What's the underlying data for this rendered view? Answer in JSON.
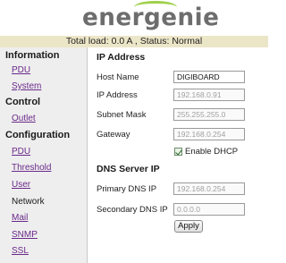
{
  "brand": {
    "logo_text": "energenie",
    "accent_color": "#9fd04a"
  },
  "status_bar": {
    "text": "Total load: 0.0 A , Status: Normal"
  },
  "sidebar": {
    "sections": [
      {
        "heading": "Information",
        "items": [
          {
            "label": "PDU"
          },
          {
            "label": "System"
          }
        ]
      },
      {
        "heading": "Control",
        "items": [
          {
            "label": "Outlet"
          }
        ]
      },
      {
        "heading": "Configuration",
        "items": [
          {
            "label": "PDU"
          },
          {
            "label": "Threshold"
          },
          {
            "label": "User"
          },
          {
            "label": "Network",
            "active": true
          },
          {
            "label": "Mail"
          },
          {
            "label": "SNMP"
          },
          {
            "label": "SSL"
          }
        ]
      }
    ]
  },
  "main": {
    "ip_section": {
      "title": "IP Address",
      "host_name": {
        "label": "Host Name",
        "value": "DIGIBOARD"
      },
      "ip_address": {
        "label": "IP Address",
        "value": "192.168.0.91"
      },
      "subnet_mask": {
        "label": "Subnet Mask",
        "value": "255.255.255.0"
      },
      "gateway": {
        "label": "Gateway",
        "value": "192.168.0.254"
      },
      "dhcp": {
        "label": "Enable DHCP",
        "checked": true
      }
    },
    "dns_section": {
      "title": "DNS Server IP",
      "primary": {
        "label": "Primary DNS IP",
        "value": "192.168.0.254"
      },
      "secondary": {
        "label": "Secondary DNS IP",
        "value": "0.0.0.0"
      }
    },
    "apply_label": "Apply"
  }
}
